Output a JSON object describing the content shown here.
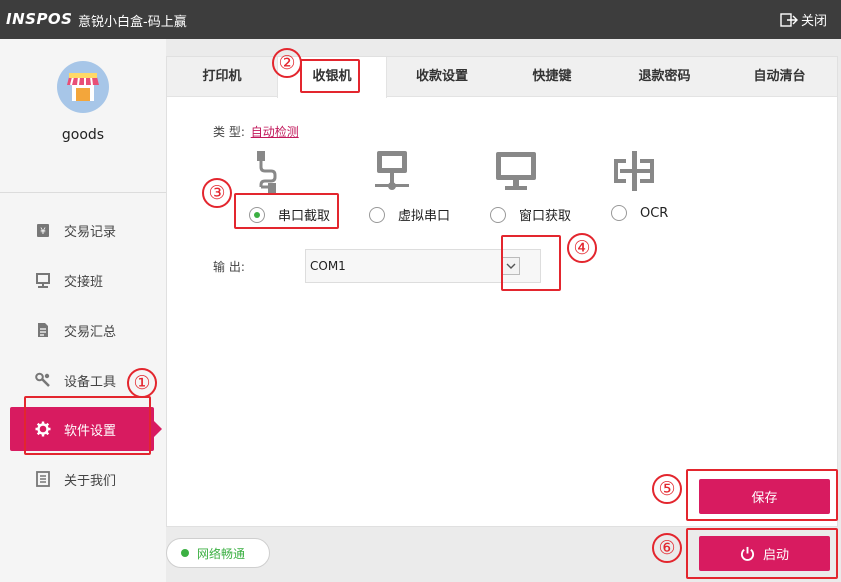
{
  "titlebar": {
    "logo": "INSPOS",
    "title": "意锐小白盒-码上赢",
    "close_label": "关闭"
  },
  "user": {
    "name": "goods"
  },
  "sidebar": {
    "items": [
      {
        "label": "交易记录",
        "icon": "receipt-icon"
      },
      {
        "label": "交接班",
        "icon": "shift-icon"
      },
      {
        "label": "交易汇总",
        "icon": "summary-icon"
      },
      {
        "label": "设备工具",
        "icon": "tools-icon"
      },
      {
        "label": "软件设置",
        "icon": "gear-icon",
        "active": true
      },
      {
        "label": "关于我们",
        "icon": "about-icon"
      }
    ]
  },
  "tabs": [
    {
      "label": "打印机"
    },
    {
      "label": "收银机",
      "active": true
    },
    {
      "label": "收款设置"
    },
    {
      "label": "快捷键"
    },
    {
      "label": "退款密码"
    },
    {
      "label": "自动清台"
    }
  ],
  "form": {
    "type_label": "类 型:",
    "type_link": "自动检测",
    "modes": [
      {
        "label": "串口截取",
        "icon": "serial-cable-icon",
        "selected": true
      },
      {
        "label": "虚拟串口",
        "icon": "network-icon",
        "selected": false
      },
      {
        "label": "窗口获取",
        "icon": "monitor-icon",
        "selected": false
      },
      {
        "label": "OCR",
        "icon": "ocr-icon",
        "selected": false
      }
    ],
    "output_label": "输 出:",
    "output_value": "COM1"
  },
  "buttons": {
    "save": "保存",
    "start": "启动"
  },
  "status": {
    "network": "网络畅通"
  },
  "annotations": [
    "①",
    "②",
    "③",
    "④",
    "⑤",
    "⑥"
  ],
  "colors": {
    "accent": "#d81b60",
    "titlebar": "#3d3d3d",
    "ok": "#3cb043",
    "annotation": "#e3262e"
  }
}
